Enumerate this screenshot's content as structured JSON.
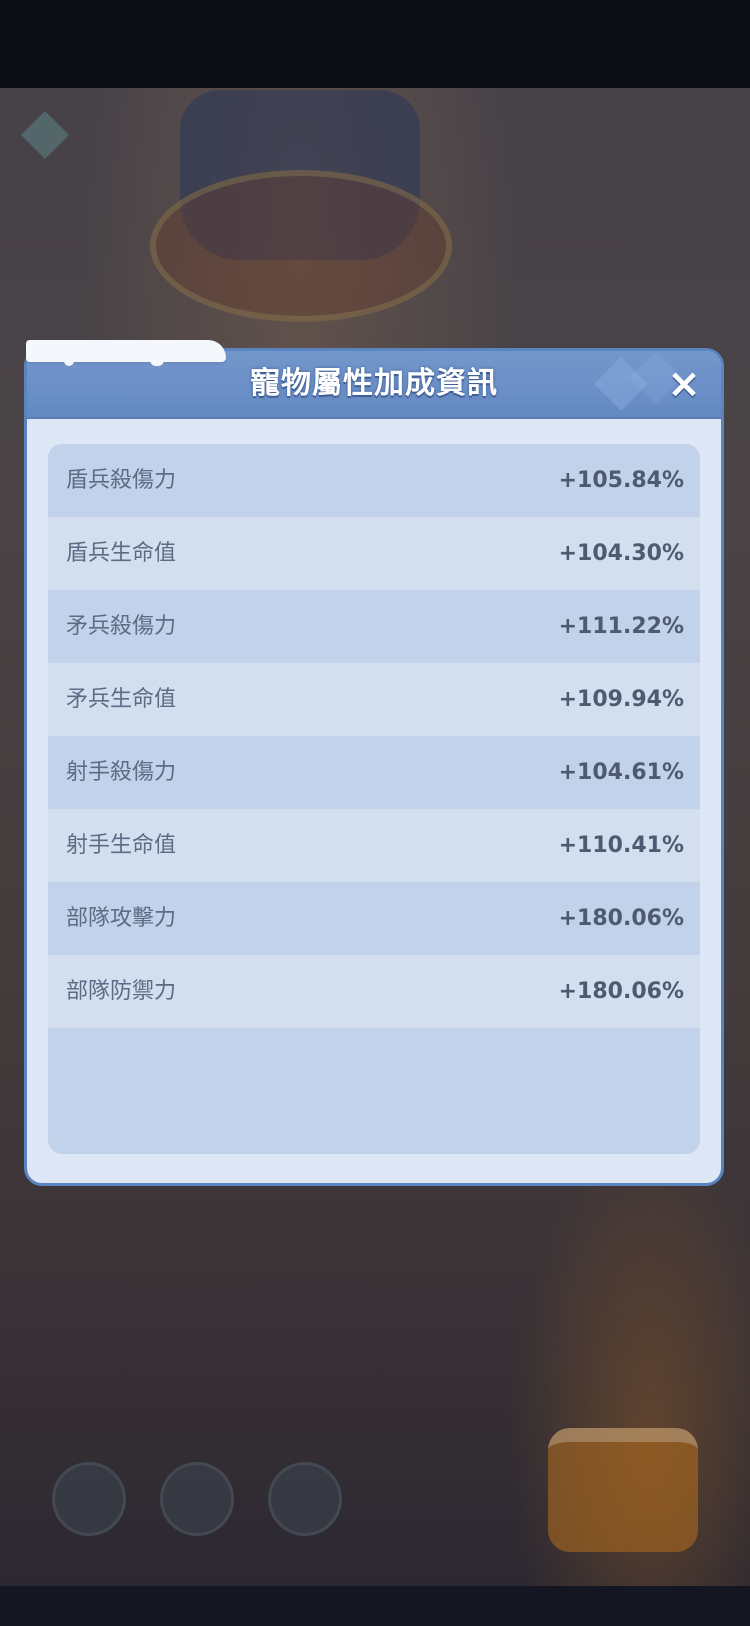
{
  "dialog": {
    "title": "寵物屬性加成資訊",
    "close_icon": "×"
  },
  "stats": [
    {
      "label": "盾兵殺傷力",
      "value": "+105.84%"
    },
    {
      "label": "盾兵生命值",
      "value": "+104.30%"
    },
    {
      "label": "矛兵殺傷力",
      "value": "+111.22%"
    },
    {
      "label": "矛兵生命值",
      "value": "+109.94%"
    },
    {
      "label": "射手殺傷力",
      "value": "+104.61%"
    },
    {
      "label": "射手生命值",
      "value": "+110.41%"
    },
    {
      "label": "部隊攻擊力",
      "value": "+180.06%"
    },
    {
      "label": "部隊防禦力",
      "value": "+180.06%"
    }
  ],
  "icons": {
    "close": "close-icon"
  },
  "colors": {
    "header": "#6489c2",
    "panel": "#dde7f5",
    "row_dark": "#c2d2ea",
    "row_light": "#d3deef",
    "text": "#5d6b84"
  }
}
